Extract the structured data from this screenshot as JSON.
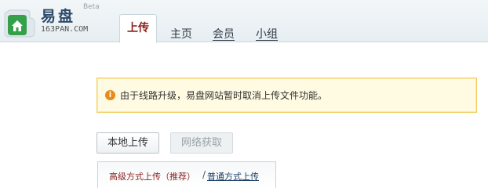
{
  "logo": {
    "title": "易盘",
    "beta": "Beta",
    "domain": "163PAN.COM"
  },
  "nav": {
    "tabs": [
      {
        "label": "上传",
        "active": true
      },
      {
        "label": "主页"
      },
      {
        "label": "会员"
      },
      {
        "label": "小组"
      }
    ]
  },
  "notice": {
    "icon": "info-icon",
    "text": "由于线路升级，易盘网站暂时取消上传文件功能。"
  },
  "upload": {
    "local_label": "本地上传",
    "net_label": "网络获取",
    "advanced_label": "高级方式上传（推荐）",
    "separator": "/",
    "normal_label": "普通方式上传"
  },
  "colors": {
    "accent": "#8b1f1f",
    "link": "#1d3f66",
    "notice_border": "#f1ce62",
    "notice_bg": "#fffbe3"
  }
}
